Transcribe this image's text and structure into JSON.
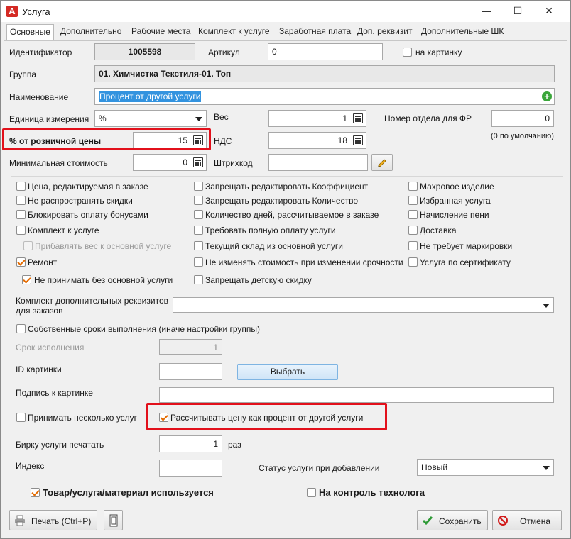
{
  "window": {
    "title": "Услуга",
    "logo_letter": "A",
    "minimize": "—",
    "maximize": "☐",
    "close": "✕"
  },
  "tabs": [
    "Основные",
    "Дополнительно",
    "Рабочие места",
    "Комплект к услуге",
    "Заработная плата",
    "Доп. реквизит",
    "Дополнительные ШК"
  ],
  "fields": {
    "id_label": "Идентификатор",
    "id_value": "1005598",
    "article_label": "Артикул",
    "article_value": "0",
    "onpic_label": "на картинку",
    "group_label": "Группа",
    "group_value": "01. Химчистка Текстиля-01. Топ",
    "name_label": "Наименование",
    "name_value": "Процент от другой услуги",
    "unit_label": "Единица измерения",
    "unit_value": "%",
    "weight_label": "Вес",
    "weight_value": "1",
    "dept_label": "Номер отдела для ФР",
    "dept_value": "0",
    "dept_hint": "(0 по умолчанию)",
    "retail_pct_label": "% от розничной цены",
    "retail_pct_value": "15",
    "vat_label": "НДС",
    "vat_value": "18",
    "min_cost_label": "Минимальная стоимость",
    "min_cost_value": "0",
    "barcode_label": "Штрихкод",
    "barcode_value": ""
  },
  "checks_col1": [
    {
      "label": "Цена, редактируемая в заказе",
      "checked": false,
      "disabled": false
    },
    {
      "label": "Не распространять скидки",
      "checked": false,
      "disabled": false
    },
    {
      "label": "Блокировать оплату бонусами",
      "checked": false,
      "disabled": false
    },
    {
      "label": "Комплект к услуге",
      "checked": false,
      "disabled": false
    },
    {
      "label": "Прибавлять вес к основной услуге",
      "checked": false,
      "disabled": true
    },
    {
      "label": "Ремонт",
      "checked": true,
      "disabled": false
    },
    {
      "label": "Не принимать без основной услуги",
      "checked": true,
      "disabled": false
    }
  ],
  "checks_col2": [
    {
      "label": "Запрещать редактировать Коэффициент",
      "checked": false
    },
    {
      "label": "Запрещать редактировать Количество",
      "checked": false
    },
    {
      "label": "Количество дней, рассчитываемое в заказе",
      "checked": false
    },
    {
      "label": "Требовать полную оплату услуги",
      "checked": false
    },
    {
      "label": "Текущий склад из основной услуги",
      "checked": false
    },
    {
      "label": "Не изменять стоимость при изменении срочности",
      "checked": false
    },
    {
      "label": "Запрещать детскую скидку",
      "checked": false
    }
  ],
  "checks_col3": [
    {
      "label": "Махровое изделие",
      "checked": false
    },
    {
      "label": "Избранная услуга",
      "checked": false
    },
    {
      "label": "Начисление пени",
      "checked": false
    },
    {
      "label": "Доставка",
      "checked": false
    },
    {
      "label": "Не требует маркировки",
      "checked": false
    },
    {
      "label": "Услуга по сертификату",
      "checked": false
    }
  ],
  "extra": {
    "kit_label": "Комплект дополнительных реквизитов для заказов",
    "own_terms_label": "Собственные сроки выполнения (иначе настройки группы)",
    "term_label": "Срок исполнения",
    "term_value": "1",
    "pic_id_label": "ID картинки",
    "pic_id_value": "",
    "choose_button": "Выбрать",
    "pic_caption_label": "Подпись к картинке",
    "pic_caption_value": "",
    "multi_label": "Принимать несколько услуг",
    "calc_pct_label": "Рассчитывать цену как процент от другой услуги",
    "tag_label": "Бирку услуги печатать",
    "tag_value": "1",
    "tag_unit": "раз",
    "index_label": "Индекс",
    "index_value": "",
    "status_label": "Статус услуги при добавлении",
    "status_value": "Новый"
  },
  "bottom": {
    "used_label": "Товар/услуга/материал используется",
    "tech_label": "На контроль технолога",
    "print_button": "Печать (Ctrl+P)",
    "save_button": "Сохранить",
    "cancel_button": "Отмена"
  },
  "colors": {
    "highlight": "#e2101b",
    "check": "#e46b00",
    "selection": "#3393df",
    "plus": "#3aa63a"
  }
}
